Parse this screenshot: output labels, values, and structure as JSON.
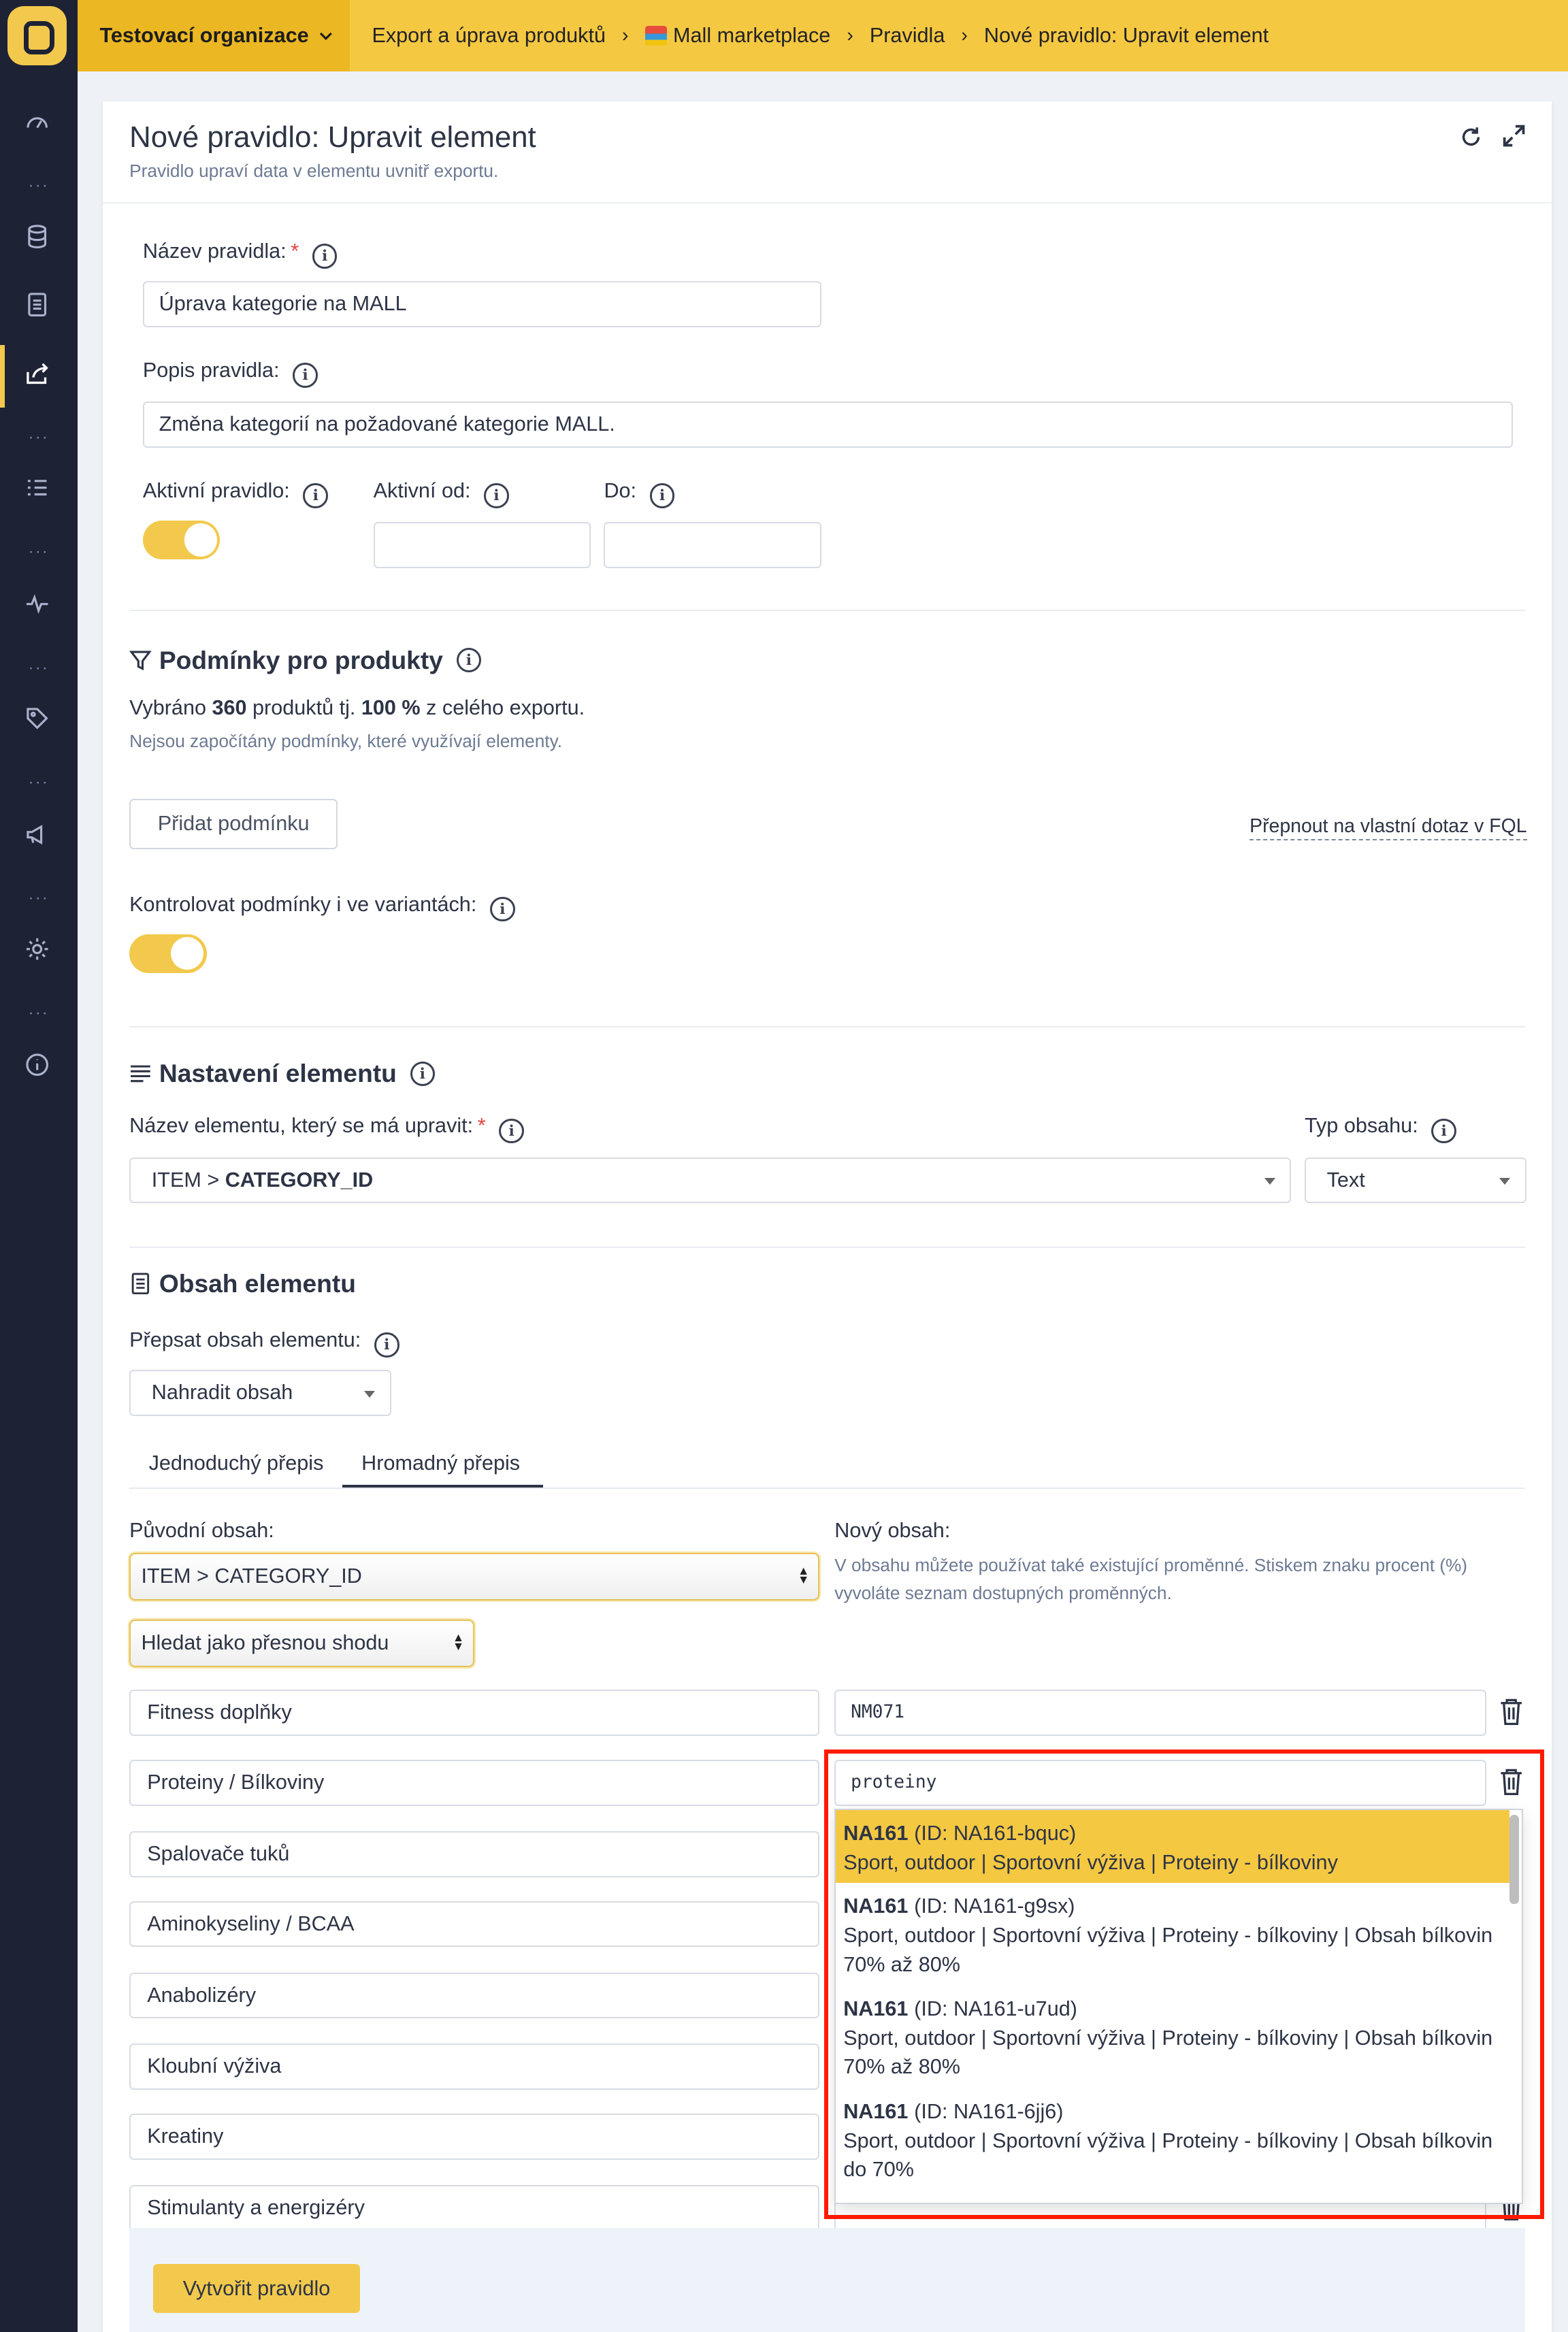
{
  "org": {
    "name": "Testovací organizace"
  },
  "breadcrumb": [
    "Export a úprava produktů",
    "Mall marketplace",
    "Pravidla",
    "Nové pravidlo: Upravit element"
  ],
  "page": {
    "title": "Nové pravidlo: Upravit element",
    "subtitle": "Pravidlo upraví data v elementu uvnitř exportu."
  },
  "form": {
    "rule_name_label": "Název pravidla:",
    "rule_name_value": "Úprava kategorie na MALL",
    "rule_desc_label": "Popis pravidla:",
    "rule_desc_value": "Změna kategorií na požadované kategorie MALL.",
    "active_label": "Aktivní pravidlo:",
    "active_from_label": "Aktivní od:",
    "active_to_label": "Do:",
    "active_on": true
  },
  "conditions": {
    "title": "Podmínky pro produkty",
    "summary_pre": "Vybráno ",
    "summary_count": "360",
    "summary_mid": " produktů tj. ",
    "summary_pct": "100 %",
    "summary_post": " z celého exportu.",
    "note": "Nejsou započítány podmínky, které využívají elementy.",
    "add_button": "Přidat podmínku",
    "fql_link": "Přepnout na vlastní dotaz v FQL",
    "variants_label": "Kontrolovat podmínky i ve variantách:",
    "variants_on": true
  },
  "element_settings": {
    "title": "Nastavení elementu",
    "name_label": "Název elementu, který se má upravit:",
    "name_prefix": "ITEM > ",
    "name_value": "CATEGORY_ID",
    "type_label": "Typ obsahu:",
    "type_value": "Text"
  },
  "element_content": {
    "title": "Obsah elementu",
    "rewrite_label": "Přepsat obsah elementu:",
    "rewrite_value": "Nahradit obsah",
    "tabs": [
      "Jednoduchý přepis",
      "Hromadný přepis"
    ],
    "active_tab": "Hromadný přepis",
    "original_label": "Původní obsah:",
    "original_select": "ITEM > CATEGORY_ID",
    "match_select": "Hledat jako přesnou shodu",
    "new_label": "Nový obsah:",
    "new_hint": "V obsahu můžete používat také existující proměnné. Stiskem znaku procent (%) vyvoláte seznam dostupných proměnných.",
    "rows": [
      {
        "original": "Fitness doplňky",
        "new": "NM071"
      },
      {
        "original": "Proteiny / Bílkoviny",
        "new": "proteiny"
      },
      {
        "original": "Spalovače tuků",
        "new": ""
      },
      {
        "original": "Aminokyseliny / BCAA",
        "new": ""
      },
      {
        "original": "Anabolizéry",
        "new": ""
      },
      {
        "original": "Kloubní výživa",
        "new": ""
      },
      {
        "original": "Kreatiny",
        "new": ""
      },
      {
        "original": "Stimulanty a energizéry",
        "new": ""
      }
    ],
    "dropdown": [
      {
        "code": "NA161",
        "id": "(ID: NA161-bquc)",
        "path": "Sport, outdoor | Sportovní výživa | Proteiny - bílkoviny"
      },
      {
        "code": "NA161",
        "id": "(ID: NA161-g9sx)",
        "path": "Sport, outdoor | Sportovní výživa | Proteiny - bílkoviny | Obsah bílkovin 70% až 80%"
      },
      {
        "code": "NA161",
        "id": "(ID: NA161-u7ud)",
        "path": "Sport, outdoor | Sportovní výživa | Proteiny - bílkoviny | Obsah bílkovin 70% až 80%"
      },
      {
        "code": "NA161",
        "id": "(ID: NA161-6jj6)",
        "path": "Sport, outdoor | Sportovní výživa | Proteiny - bílkoviny | Obsah bílkovin do 70%"
      }
    ]
  },
  "footer": {
    "create_button": "Vytvořit pravidlo"
  },
  "colors": {
    "accent": "#f5c842",
    "sidebar": "#1e2235",
    "highlight_frame": "#ff1a00"
  }
}
